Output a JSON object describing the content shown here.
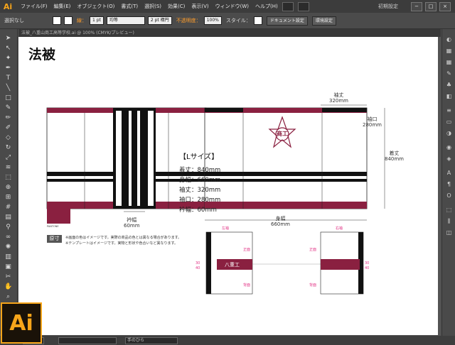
{
  "app": {
    "logo": "Ai"
  },
  "menus": [
    "ファイル(F)",
    "編集(E)",
    "オブジェクト(O)",
    "書式(T)",
    "選択(S)",
    "効果(C)",
    "表示(V)",
    "ウィンドウ(W)",
    "ヘルプ(H)"
  ],
  "workspace": {
    "label": "初期設定"
  },
  "window_buttons": [
    "−",
    "□",
    "×"
  ],
  "control_bar": {
    "selection": "選択なし",
    "stroke_label": "線：",
    "stroke_weight": "1 pt",
    "stroke_profile": "均等",
    "brush": "2 pt 楕円",
    "opacity_label": "不透明度：",
    "opacity_value": "100%",
    "style_label": "スタイル：",
    "doc_setup": "ドキュメント設定",
    "prefs": "環境設定"
  },
  "document_tab": {
    "title": "法被_八重山商工高等学校.ai @ 100% (CMYK/プレビュー)"
  },
  "status_bar": {
    "zoom": "",
    "tool": "手のひら"
  },
  "artboard": {
    "title": "法被",
    "spec_title": "【Lサイズ】",
    "specs": [
      "着丈：840mm",
      "身幅：660mm",
      "袖丈：320mm",
      "袖口：280mm",
      "衿幅：60mm"
    ],
    "collar_text": "八重山商工高等学校",
    "pantone_label": "PANTONE",
    "gensun": "原寸",
    "notes": [
      "※画面の色はイメージです。実際の商品の色とは異なる場合があります。",
      "※テンプレートはイメージです。実物と形状や色合いなど異なります。"
    ],
    "dim_sleeve_length": "袖丈\n320mm",
    "dim_cuff": "袖口\n280mm",
    "dim_total_length": "着丈\n840mm",
    "dim_collar": "衿幅\n60mm",
    "dim_body_width": "身幅\n660mm",
    "left_sleeve": "左袖",
    "right_sleeve": "右袖",
    "front": "正面",
    "back": "背面",
    "sleeve_text": "八重工",
    "size_marks": [
      "30",
      "40"
    ],
    "emblem_text": "商工"
  },
  "colors": {
    "maroon": "#8a2040",
    "accent": "#f7a51a",
    "pink": "#e23486"
  }
}
